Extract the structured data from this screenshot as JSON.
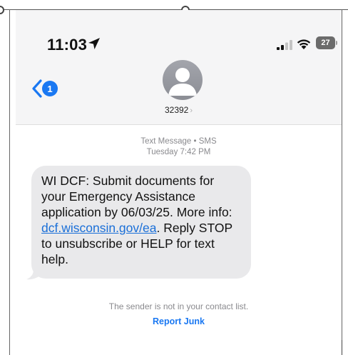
{
  "status_bar": {
    "time": "11:03",
    "battery_level": "27"
  },
  "header": {
    "unread_count": "1",
    "contact_name": "32392",
    "contact_chevron": "›"
  },
  "thread": {
    "service_label": "Text Message • SMS",
    "timestamp": "Tuesday 7:42 PM",
    "message": {
      "text_before_link": "WI DCF: Submit documents for your Emergency Assistance application by 06/03/25. More info: ",
      "link_text": "dcf.wisconsin.gov/ea",
      "text_after_link": ". Reply STOP to unsubscribe or HELP for text help."
    }
  },
  "footer": {
    "not_in_contacts": "The sender is not in your contact list.",
    "report_junk": "Report Junk"
  },
  "colors": {
    "accent": "#1a78f2",
    "bubble": "#e9e9eb",
    "header_bg": "#f5f5f6"
  },
  "icons": [
    "location-arrow-icon",
    "signal-icon",
    "wifi-icon",
    "battery-icon",
    "back-chevron-icon",
    "avatar-person-icon"
  ]
}
